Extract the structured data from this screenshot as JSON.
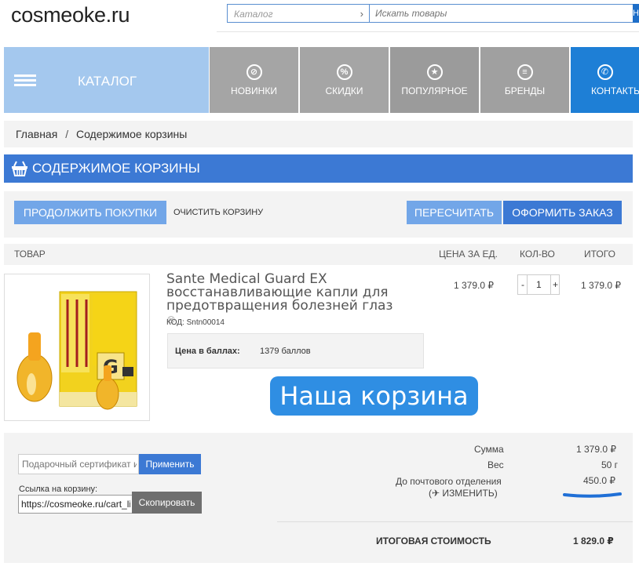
{
  "header": {
    "logo": "cosmeoke.ru",
    "catalog_select": "Каталог",
    "search_placeholder": "Искать товары",
    "search_button": "Н"
  },
  "nav": {
    "catalog": "КАТАЛОГ",
    "items": [
      {
        "label": "НОВИНКИ",
        "icon": "tag-icon",
        "glyph": "⊘"
      },
      {
        "label": "СКИДКИ",
        "icon": "percent-icon",
        "glyph": "%"
      },
      {
        "label": "ПОПУЛЯРНОЕ",
        "icon": "star-icon",
        "glyph": "★"
      },
      {
        "label": "БРЕНДЫ",
        "icon": "list-icon",
        "glyph": "≡"
      },
      {
        "label": "КОНТАКТЫ",
        "icon": "phone-icon",
        "glyph": "✆"
      }
    ],
    "colors": {
      "catalog": "#a4c8ee",
      "item": "#a5a5a5",
      "active": "#1e7fd6"
    }
  },
  "breadcrumb": {
    "home": "Главная",
    "sep": "/",
    "current": "Содержимое корзины"
  },
  "page_title": "СОДЕРЖИМОЕ КОРЗИНЫ",
  "actions": {
    "continue": "ПРОДОЛЖИТЬ ПОКУПКИ",
    "clear": "ОЧИСТИТЬ КОРЗИНУ",
    "recalc": "ПЕРЕСЧИТАТЬ",
    "checkout": "ОФОРМИТЬ ЗАКАЗ"
  },
  "table": {
    "columns": {
      "product": "ТОВАР",
      "price": "ЦЕНА ЗА ЕД.",
      "qty": "КОЛ-ВО",
      "total": "ИТОГО"
    }
  },
  "item": {
    "title": "Sante Medical Guard EX восстанавливающие капли для предотвращения болезней глаз",
    "code": "КОД: Sntn00014",
    "points_label": "Цена в баллах:",
    "points_value": "1379 баллов",
    "price": "1 379.0 ₽",
    "quantity": "1",
    "qty_minus": "-",
    "qty_plus": "+",
    "total": "1 379.0 ₽",
    "remove_icon": "⊗"
  },
  "overlay_banner": "Наша корзина",
  "bottom": {
    "gift_placeholder": "Подарочный сертификат или",
    "apply": "Применить",
    "link_label": "Ссылка на корзину:",
    "link_value": "https://cosmeoke.ru/cart_link",
    "copy": "Скопировать",
    "summary": {
      "sum_label": "Сумма",
      "sum_value": "1 379.0 ₽",
      "weight_label": "Вес",
      "weight_value": "50 г",
      "post_label": "До почтового отделения",
      "post_value": "450.0 ₽",
      "change_label": "✈ ИЗМЕНИТЬ)",
      "change_prefix": "(",
      "grand_label": "ИТОГОВАЯ СТОИМОСТЬ",
      "grand_value": "1 829.0 ₽"
    }
  }
}
